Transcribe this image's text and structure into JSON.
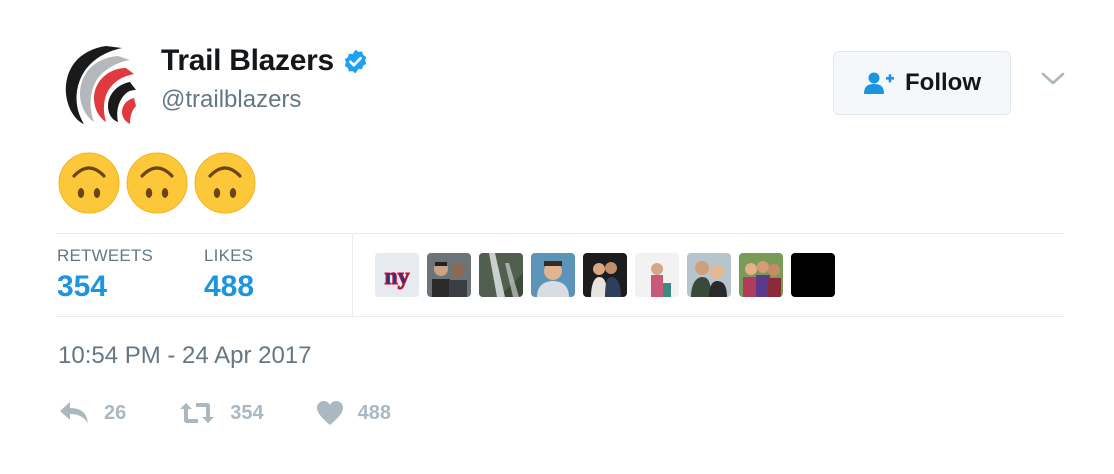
{
  "tweet": {
    "author": {
      "name": "Trail Blazers",
      "handle": "@trailblazers",
      "verified": true
    },
    "follow": {
      "label": "Follow",
      "icon": "add-user-icon"
    },
    "body": {
      "emoji": [
        "🙃",
        "🙃",
        "🙃"
      ]
    },
    "stats": {
      "retweets": {
        "label": "RETWEETS",
        "value": "354"
      },
      "likes": {
        "label": "LIKES",
        "value": "488"
      }
    },
    "likers": [
      "ny-giants-avatar",
      "two-friends-avatar",
      "waterfall-avatar",
      "man-portrait-avatar",
      "couple-avatar",
      "person-white-wall-avatar",
      "two-men-avatar",
      "group-avatar",
      "black-avatar"
    ],
    "timestamp": "10:54 PM - 24 Apr 2017",
    "actions": {
      "reply": {
        "icon": "reply-icon",
        "count": "26"
      },
      "retweet": {
        "icon": "retweet-icon",
        "count": "354"
      },
      "like": {
        "icon": "heart-icon",
        "count": "488"
      }
    }
  },
  "colors": {
    "accent": "#1b95e0",
    "muted": "#657786",
    "action": "#aab8c2",
    "verified": "#1da1f2"
  }
}
